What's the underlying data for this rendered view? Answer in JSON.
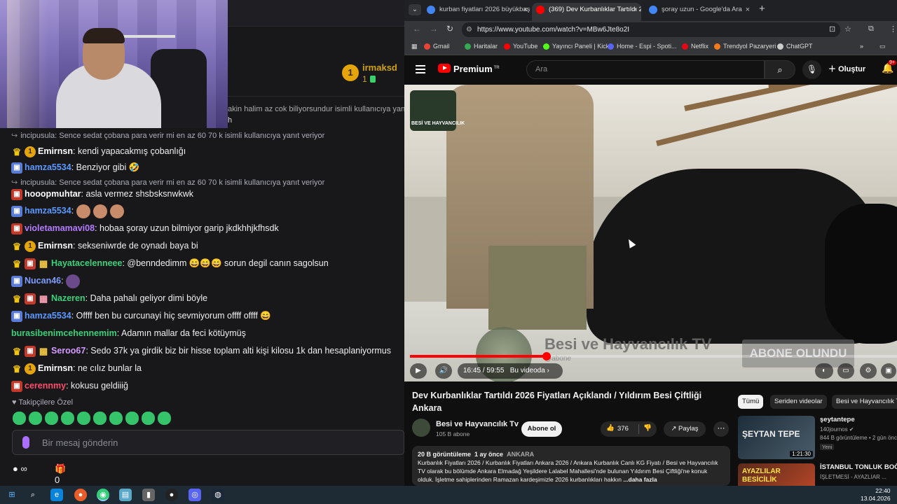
{
  "stream": {
    "streamer_name": "irmaksd",
    "streamer_count": "1",
    "reply_strip": "akin halim az cok biliyorsundur isimli kullanıcıya yanıt",
    "reply_strip2": "h",
    "chat": [
      {
        "type": "reply",
        "text": "incipusula: Sence sedat çobana para verir mi en az 60 70 k isimli kullanıcıya yanıt veriyor"
      },
      {
        "type": "msg",
        "badges": [
          "crown",
          "num"
        ],
        "user": "Emirnsn",
        "color": "#ffffff",
        "text": "kendi yapacakmış çobanlığı"
      },
      {
        "type": "msg",
        "badges": [
          "twitch"
        ],
        "user": "hamza5534",
        "color": "#5b99ff",
        "text": "Benziyor gibi 🤣"
      },
      {
        "type": "reply",
        "text": "incipusula: Sence sedat çobana para verir mi en az 60 70 k isimli kullanıcıya yanıt veriyor"
      },
      {
        "type": "msg",
        "badges": [
          "mod"
        ],
        "user": "hooopmuhtar",
        "color": "#ffffff",
        "text": "asla vermez shsbsksnwkwk"
      },
      {
        "type": "msg",
        "badges": [
          "twitch"
        ],
        "user": "hamza5534",
        "color": "#5b99ff",
        "text": "",
        "emotes": 3
      },
      {
        "type": "msg",
        "badges": [
          "mod"
        ],
        "user": "violetamamavi08",
        "color": "#b57bff",
        "text": "hobaa şoray uzun bilmiyor garip jkdkhhjkfhsdk"
      },
      {
        "type": "msg",
        "badges": [
          "crown",
          "num"
        ],
        "user": "Emirnsn",
        "color": "#ffffff",
        "text": "sekseniwrde de oynadı baya bi"
      },
      {
        "type": "msg",
        "badges": [
          "crown",
          "mod",
          "box"
        ],
        "user": "Hayatacelenneee",
        "color": "#3ad17a",
        "text": "@benndedimm 😄😄😄 sorun degil canın sagolsun"
      },
      {
        "type": "msg",
        "badges": [
          "twitch"
        ],
        "user": "Nucan46",
        "color": "#7d9cff",
        "text": "",
        "emotes": 1
      },
      {
        "type": "msg",
        "badges": [
          "crown",
          "mod",
          "gift"
        ],
        "user": "Nazeren",
        "color": "#3ad17a",
        "text": "Daha pahalı geliyor dimi böyle"
      },
      {
        "type": "msg",
        "badges": [
          "twitch"
        ],
        "user": "hamza5534",
        "color": "#5b99ff",
        "text": "Offff ben bu curcunayi hiç sevmiyorum offff offff 😄"
      },
      {
        "type": "msg",
        "badges": [],
        "user": "burasibenimcehennemim",
        "color": "#3ad17a",
        "text": "Adamın mallar da feci kötüymüş"
      },
      {
        "type": "msg",
        "badges": [
          "crown",
          "mod",
          "box"
        ],
        "user": "Seroo67",
        "color": "#d49bff",
        "text": "Sedo 37k ya girdik biz bir hisse toplam alti kişi kilosu 1k dan hesaplaniyormus"
      },
      {
        "type": "msg",
        "badges": [
          "crown",
          "num"
        ],
        "user": "Emirnsn",
        "color": "#ffffff",
        "text": "ne cılız bunlar la"
      },
      {
        "type": "msg",
        "badges": [
          "mod"
        ],
        "user": "cerennmy",
        "color": "#ff4d6a",
        "text": "kokusu geldiiiğ"
      }
    ],
    "followers_label": "♥ Takipçilere Özel",
    "input_placeholder": "Bir mesaj gönderin",
    "points_label": "∞",
    "gift_count": "0"
  },
  "browser": {
    "tabs": [
      {
        "label": "kurban fiyatları 2026 büyükbaş",
        "active": false,
        "fav": "#4285f4"
      },
      {
        "label": "(369) Dev Kurbanlıklar Tartıldı 2",
        "active": true,
        "fav": "#ff0000"
      },
      {
        "label": "şoray uzun - Google'da Ara",
        "active": false,
        "fav": "#4285f4"
      }
    ],
    "url": "https://www.youtube.com/watch?v=MBw6Jte8o2I",
    "bookmarks": [
      {
        "label": "Gmail",
        "color": "#ea4335"
      },
      {
        "label": "Haritalar",
        "color": "#34a853"
      },
      {
        "label": "YouTube",
        "color": "#ff0000"
      },
      {
        "label": "Yayıncı Paneli | Kick",
        "color": "#53fc18"
      },
      {
        "label": "Home - Espi - Spoti...",
        "color": "#5865f2"
      },
      {
        "label": "Netflix",
        "color": "#e50914"
      },
      {
        "label": "Trendyol Pazaryeri",
        "color": "#f27a1a"
      },
      {
        "label": "ChatGPT",
        "color": "#cccccc"
      }
    ]
  },
  "youtube": {
    "brand": "Premium",
    "brand_sup": "TR",
    "search_placeholder": "Ara",
    "create_label": "Oluştur",
    "notif_count": "9+",
    "video": {
      "channel_watermark": "BESİ VE HAYVANCILIK",
      "overlay_title": "Besi ve Hayvancılık TV",
      "overlay_sub": "@abone",
      "overlay_button": "ABONE OLUNDU",
      "time": "16:45 / 59:55",
      "chapter": "Bu videoda ›",
      "progress": 0.2804
    },
    "title": "Dev Kurbanlıklar Tartıldı 2026 Fiyatları Açıklandı / Yıldırım Besi Çiftliği Ankara",
    "channel_name": "Besi ve Hayvancılık Tv",
    "subscribers": "105 B abone",
    "subscribe_label": "Abone ol",
    "likes": "376",
    "share_label": "Paylaş",
    "desc_views": "20 B görüntüleme",
    "desc_age": "1 ay önce",
    "desc_loc": "ANKARA",
    "desc_text": "Kurbanlık Fiyatları 2026 / Kurbanlık Fiyatları Ankara 2026 / Ankara Kurbanlık Canlı KG Fiyatı / Besi ve Hayvancılık TV olarak bu bölümde Ankara Elmadağ Yeşildere Lalabel Mahallesi'nde bulunan Yıldırım Besi Çiftliği'ne konuk olduk. İşletme sahiplerinden Ramazan kardeşimizle 2026 kurbanlıkları hakkın",
    "desc_more": "...daha fazla",
    "chips": [
      "Tümü",
      "Seriden videolar",
      "Besi ve Hayvancılık T"
    ],
    "recs": [
      {
        "title": "şeytantepe",
        "channel": "140journos ✔",
        "meta": "844 B görüntüleme • 2 gün önce",
        "badge": "Yeni",
        "duration": "1:21:30",
        "thumb_text": "ŞEYTAN TEPE"
      },
      {
        "title": "İSTANBUL TONLUK BOĞA",
        "channel": "İŞLETMESİ - AYAZLIAR ...",
        "meta": "",
        "badge": "",
        "duration": "",
        "thumb_text": "AYAZLILAR BESİCİLİK"
      }
    ]
  },
  "taskbar": {
    "time": "22:40",
    "date": "13.04.2026"
  }
}
